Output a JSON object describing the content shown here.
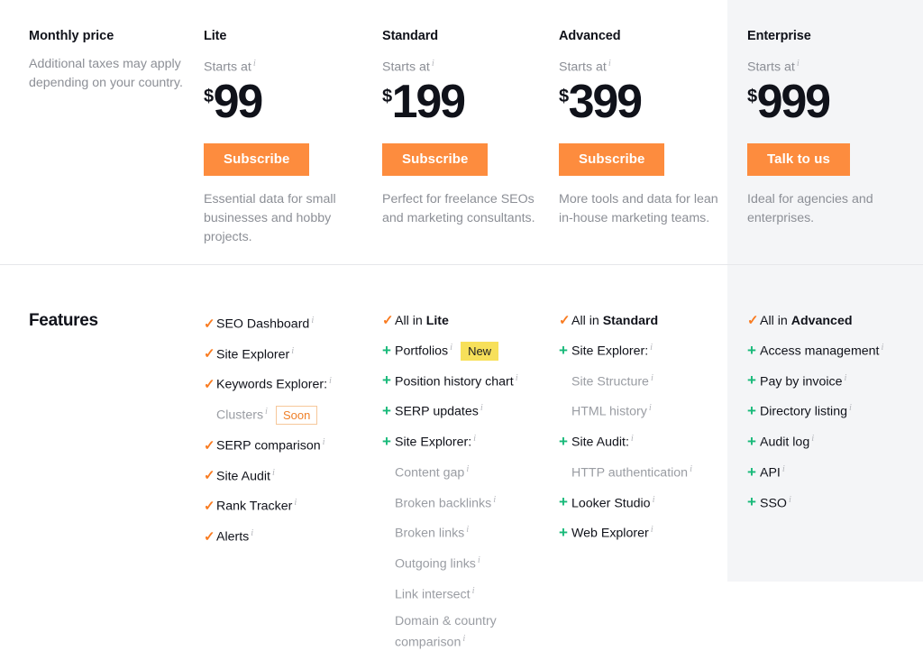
{
  "colors": {
    "accent_orange": "#fd8c3e",
    "check_orange": "#f97b20",
    "plus_green": "#17b979",
    "badge_new_bg": "#f7e05a",
    "highlight_panel_bg": "#f4f5f7",
    "muted_text": "#8c8f96"
  },
  "pricing": {
    "intro": {
      "title": "Monthly price",
      "note": "Additional taxes may apply depending on your country."
    },
    "starts_at_label": "Starts at",
    "currency": "$",
    "plans": [
      {
        "name": "Lite",
        "price": "99",
        "cta": "Subscribe",
        "description": "Essential data for small businesses and hobby projects."
      },
      {
        "name": "Standard",
        "price": "199",
        "cta": "Subscribe",
        "description": "Perfect for freelance SEOs and marketing consultants."
      },
      {
        "name": "Advanced",
        "price": "399",
        "cta": "Subscribe",
        "description": "More tools and data for lean in-house marketing teams."
      },
      {
        "name": "Enterprise",
        "price": "999",
        "cta": "Talk to us",
        "description": "Ideal for agencies and enterprises.",
        "highlighted": true
      }
    ]
  },
  "features": {
    "title": "Features",
    "columns": [
      {
        "plan": "Lite",
        "items": [
          {
            "mark": "check",
            "label": "SEO Dashboard",
            "info": true
          },
          {
            "mark": "check",
            "label": "Site Explorer",
            "info": true
          },
          {
            "mark": "check",
            "label": "Keywords Explorer:",
            "info": true
          },
          {
            "mark": "none",
            "sub": true,
            "label": "Clusters",
            "info": true,
            "badge": "Soon",
            "badge_type": "soon"
          },
          {
            "mark": "check",
            "label": "SERP comparison",
            "info": true
          },
          {
            "mark": "check",
            "label": "Site Audit",
            "info": true
          },
          {
            "mark": "check",
            "label": "Rank Tracker",
            "info": true
          },
          {
            "mark": "check",
            "label": "Alerts",
            "info": true
          }
        ]
      },
      {
        "plan": "Standard",
        "items": [
          {
            "mark": "check",
            "label": "All in ",
            "bold": "Lite"
          },
          {
            "mark": "plus",
            "label": "Portfolios",
            "info": true,
            "badge": "New",
            "badge_type": "new"
          },
          {
            "mark": "plus",
            "label": "Position history chart",
            "info": true
          },
          {
            "mark": "plus",
            "label": "SERP updates",
            "info": true
          },
          {
            "mark": "plus",
            "label": "Site Explorer:",
            "info": true
          },
          {
            "mark": "none",
            "sub": true,
            "label": "Content gap",
            "info": true
          },
          {
            "mark": "none",
            "sub": true,
            "label": "Broken backlinks",
            "info": true
          },
          {
            "mark": "none",
            "sub": true,
            "label": "Broken links",
            "info": true
          },
          {
            "mark": "none",
            "sub": true,
            "label": "Outgoing links",
            "info": true
          },
          {
            "mark": "none",
            "sub": true,
            "label": "Link intersect",
            "info": true
          },
          {
            "mark": "none",
            "sub": true,
            "label": "Domain & country",
            "wrap": "comparison",
            "info": true
          }
        ]
      },
      {
        "plan": "Advanced",
        "items": [
          {
            "mark": "check",
            "label": "All in ",
            "bold": "Standard"
          },
          {
            "mark": "plus",
            "label": "Site Explorer:",
            "info": true
          },
          {
            "mark": "none",
            "sub": true,
            "label": "Site Structure",
            "info": true
          },
          {
            "mark": "none",
            "sub": true,
            "label": "HTML history",
            "info": true
          },
          {
            "mark": "plus",
            "label": "Site Audit:",
            "info": true
          },
          {
            "mark": "none",
            "sub": true,
            "label": "HTTP authentication",
            "info": true
          },
          {
            "mark": "plus",
            "label": "Looker Studio",
            "info": true
          },
          {
            "mark": "plus",
            "label": "Web Explorer",
            "info": true
          }
        ]
      },
      {
        "plan": "Enterprise",
        "items": [
          {
            "mark": "check",
            "label": "All in ",
            "bold": "Advanced"
          },
          {
            "mark": "plus",
            "label": "Access management",
            "info": true
          },
          {
            "mark": "plus",
            "label": "Pay by invoice",
            "info": true
          },
          {
            "mark": "plus",
            "label": "Directory listing",
            "info": true
          },
          {
            "mark": "plus",
            "label": "Audit log",
            "info": true
          },
          {
            "mark": "plus",
            "label": "API",
            "info": true
          },
          {
            "mark": "plus",
            "label": "SSO",
            "info": true
          }
        ]
      }
    ]
  }
}
